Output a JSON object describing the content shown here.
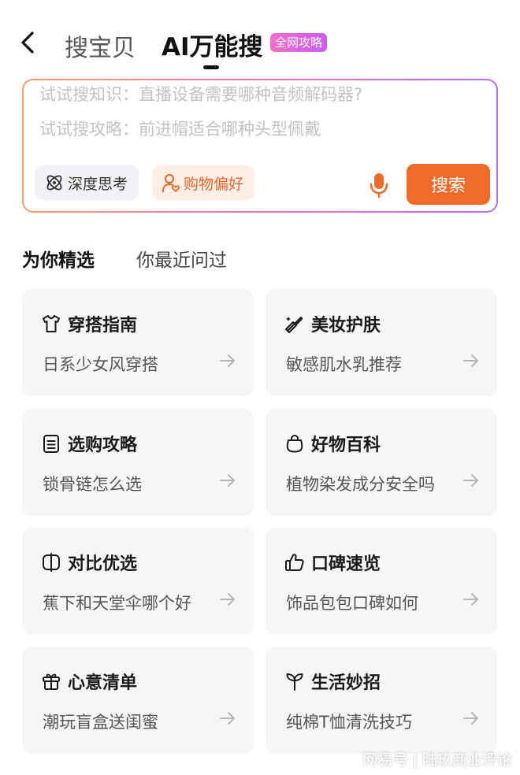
{
  "header": {
    "tab_baobei": "搜宝贝",
    "tab_ai": "AI万能搜",
    "badge": "全网攻略"
  },
  "search": {
    "hint_knowledge": "试试搜知识：直播设备需要哪种音频解码器?",
    "hint_guide": "试试搜攻略：前进帽适合哪种头型佩戴",
    "chip_deep": "深度思考",
    "chip_pref": "购物偏好",
    "button": "搜索"
  },
  "section": {
    "tab_selected": "为你精选",
    "tab_recent": "你最近问过"
  },
  "cards": [
    {
      "title": "穿搭指南",
      "query": "日系少女风穿搭",
      "icon": "shirt-icon"
    },
    {
      "title": "美妆护肤",
      "query": "敏感肌水乳推荐",
      "icon": "makeup-icon"
    },
    {
      "title": "选购攻略",
      "query": "锁骨链怎么选",
      "icon": "clipboard-icon"
    },
    {
      "title": "好物百科",
      "query": "植物染发成分安全吗",
      "icon": "bag-icon"
    },
    {
      "title": "对比优选",
      "query": "蕉下和天堂伞哪个好",
      "icon": "compare-icon"
    },
    {
      "title": "口碑速览",
      "query": "饰品包包口碑如何",
      "icon": "thumbs-up-icon"
    },
    {
      "title": "心意清单",
      "query": "潮玩盲盒送闺蜜",
      "icon": "gift-icon"
    },
    {
      "title": "生活妙招",
      "query": "纯棉T恤清洗技巧",
      "icon": "sprout-icon"
    }
  ],
  "watermark": "网易号 | 陆玖商业评论",
  "colors": {
    "accent": "#f06a28",
    "badge_gradient": [
      "#f46ec9",
      "#c95cf2"
    ],
    "card_bg": "#f5f6f8"
  }
}
